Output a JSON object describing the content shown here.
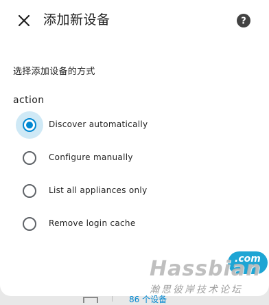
{
  "dialog": {
    "title": "添加新设备",
    "close_icon": "close-icon",
    "help_icon": "help-circle-icon",
    "subtitle": "选择添加设备的方式",
    "field_label": "action",
    "accent_color": "#0288d1",
    "options": [
      {
        "label": "Discover automatically",
        "selected": true
      },
      {
        "label": "Configure manually",
        "selected": false
      },
      {
        "label": "List all appliances only",
        "selected": false
      },
      {
        "label": "Remove login cache",
        "selected": false
      }
    ]
  },
  "background": {
    "device_count_text": "86 个设备"
  },
  "watermark": {
    "main": "Hassbian",
    "com": ".com",
    "sub": "瀚思彼岸技术论坛"
  }
}
